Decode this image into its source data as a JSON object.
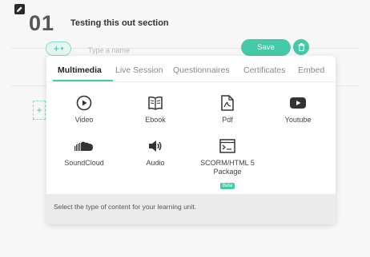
{
  "section": {
    "number": "01",
    "title": "Testing this out section"
  },
  "toolbar": {
    "name_placeholder": "Type a name",
    "save_label": "Save"
  },
  "tabs": [
    {
      "label": "Multimedia",
      "active": true
    },
    {
      "label": "Live Session",
      "active": false
    },
    {
      "label": "Questionnaires",
      "active": false
    },
    {
      "label": "Certificates",
      "active": false
    },
    {
      "label": "Embed",
      "active": false
    }
  ],
  "content_types": [
    {
      "label": "Video",
      "icon": "play-circle-icon"
    },
    {
      "label": "Ebook",
      "icon": "book-icon"
    },
    {
      "label": "Pdf",
      "icon": "pdf-icon"
    },
    {
      "label": "Youtube",
      "icon": "youtube-icon"
    },
    {
      "label": "SoundCloud",
      "icon": "soundcloud-icon"
    },
    {
      "label": "Audio",
      "icon": "speaker-icon"
    },
    {
      "label": "SCORM/HTML 5 Package",
      "icon": "scorm-icon",
      "badge": "Beta"
    }
  ],
  "footer": {
    "hint": "Select the type of content for your learning unit."
  },
  "colors": {
    "accent": "#46c9a9",
    "accent_light": "#e4f6f2",
    "footer_bg": "#ebebeb"
  }
}
